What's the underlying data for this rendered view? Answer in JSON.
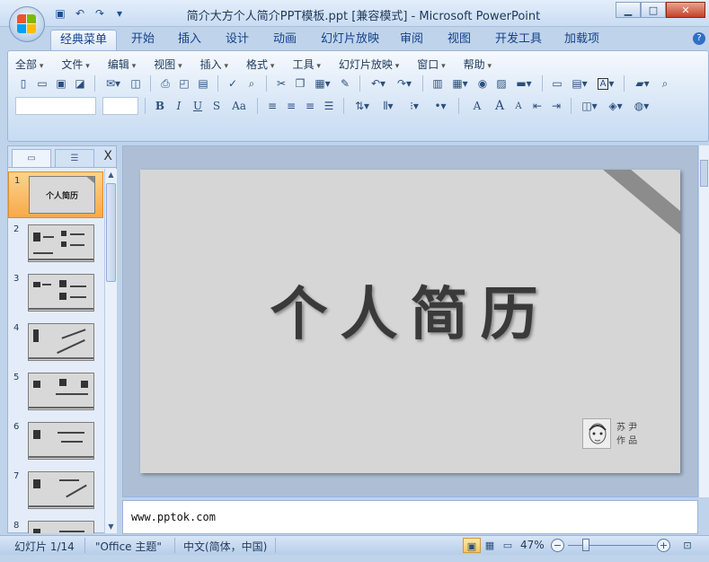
{
  "window": {
    "title": "简介大方个人简介PPT模板.ppt [兼容模式] - Microsoft PowerPoint",
    "minimize": "▁",
    "maximize": "□",
    "close": "✕"
  },
  "qat": [
    "save-icon",
    "undo-icon",
    "redo-icon",
    "customize-icon"
  ],
  "ribbon_tabs": [
    "经典菜单",
    "开始",
    "插入",
    "设计",
    "动画",
    "幻灯片放映",
    "审阅",
    "视图",
    "开发工具",
    "加载项"
  ],
  "active_tab": "经典菜单",
  "classic_menu": [
    "全部",
    "文件",
    "编辑",
    "视图",
    "插入",
    "格式",
    "工具",
    "幻灯片放映",
    "窗口",
    "帮助"
  ],
  "format_buttons": {
    "bold": "B",
    "italic": "I",
    "underline": "U",
    "shadow": "S",
    "change_case": "Aa",
    "font_color": "A",
    "grow": "A",
    "shrink": "A",
    "textbox": "A"
  },
  "panel": {
    "close": "X",
    "slides": [
      {
        "num": "1",
        "title": "个人简历",
        "selected": true
      },
      {
        "num": "2"
      },
      {
        "num": "3"
      },
      {
        "num": "4"
      },
      {
        "num": "5"
      },
      {
        "num": "6"
      },
      {
        "num": "7"
      },
      {
        "num": "8"
      }
    ]
  },
  "slide": {
    "title": "个人简历",
    "signature_line1": "苏 尹",
    "signature_line2": "作 品"
  },
  "notes": {
    "text": "www.pptok.com"
  },
  "status": {
    "slide_info": "幻灯片 1/14",
    "theme": "\"Office 主题\"",
    "language": "中文(简体，中国)",
    "zoom": "47%",
    "zoom_value": 0.47
  },
  "colors": {
    "accent": "#bfd3ea",
    "selected_thumb": "#f7a94a",
    "slide_bg": "#d6d6d6"
  }
}
